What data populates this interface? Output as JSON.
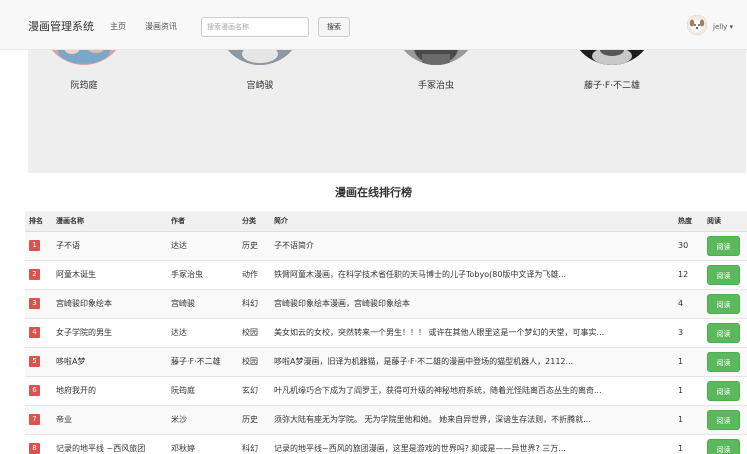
{
  "nav": {
    "brand": "漫画管理系统",
    "home": "主页",
    "news": "漫画资讯",
    "search_placeholder": "搜索漫画名称",
    "search_button": "搜索",
    "username": "jelly ▾"
  },
  "authors": [
    "阮筠庭",
    "宫崎骏",
    "手冢治虫",
    "藤子·F·不二雄"
  ],
  "ranking": {
    "title": "漫画在线排行榜",
    "headers": [
      "排名",
      "漫画名称",
      "作者",
      "分类",
      "简介",
      "热度",
      "阅读"
    ],
    "read_label": "阅读",
    "rows": [
      {
        "rank": "1",
        "name": "子不语",
        "author": "达达",
        "category": "历史",
        "intro": "子不语简介",
        "heat": "30"
      },
      {
        "rank": "2",
        "name": "阿童木诞生",
        "author": "手冢治虫",
        "category": "动作",
        "intro": "铁臂阿童木漫画，在科学技术省任职的天马博士的儿子Tobyo(80版中文译为飞雄...",
        "heat": "12"
      },
      {
        "rank": "3",
        "name": "宫崎骏印象绘本",
        "author": "宫崎骏",
        "category": "科幻",
        "intro": "宫崎骏印象绘本漫画，宫崎骏印象绘本",
        "heat": "4"
      },
      {
        "rank": "4",
        "name": "女子学院的男生",
        "author": "达达",
        "category": "校园",
        "intro": "美女如云的女校，突然转来一个男生！！！ 或许在其他人眼里这是一个梦幻的天堂，可事实...",
        "heat": "3"
      },
      {
        "rank": "5",
        "name": "哆啦A梦",
        "author": "藤子·F·不二雄",
        "category": "校园",
        "intro": "哆啦A梦漫画，旧译为机器猫，是藤子·F·不二雄的漫画中登场的猫型机器人，2112...",
        "heat": "1"
      },
      {
        "rank": "6",
        "name": "地府我开的",
        "author": "阮筠庭",
        "category": "玄幻",
        "intro": "叶凡机缘巧合下成为了阎罗王，获得可升级的神秘地府系统，随着光怪陆离百态丛生的离奇...",
        "heat": "1"
      },
      {
        "rank": "7",
        "name": "帝业",
        "author": "米沙",
        "category": "历史",
        "intro": "须弥大陆有座无为学院。 无为学院里他和她。 她来自异世界，深谙生存法则，不折腾就...",
        "heat": "1"
      },
      {
        "rank": "8",
        "name": "记录的地平线 ~西风旅团",
        "author": "邓秋婷",
        "category": "科幻",
        "intro": "记录的地平线~西风的旅团漫画，这里是游戏的世界吗? 抑或是——异世界? 三万...",
        "heat": "1"
      }
    ]
  }
}
